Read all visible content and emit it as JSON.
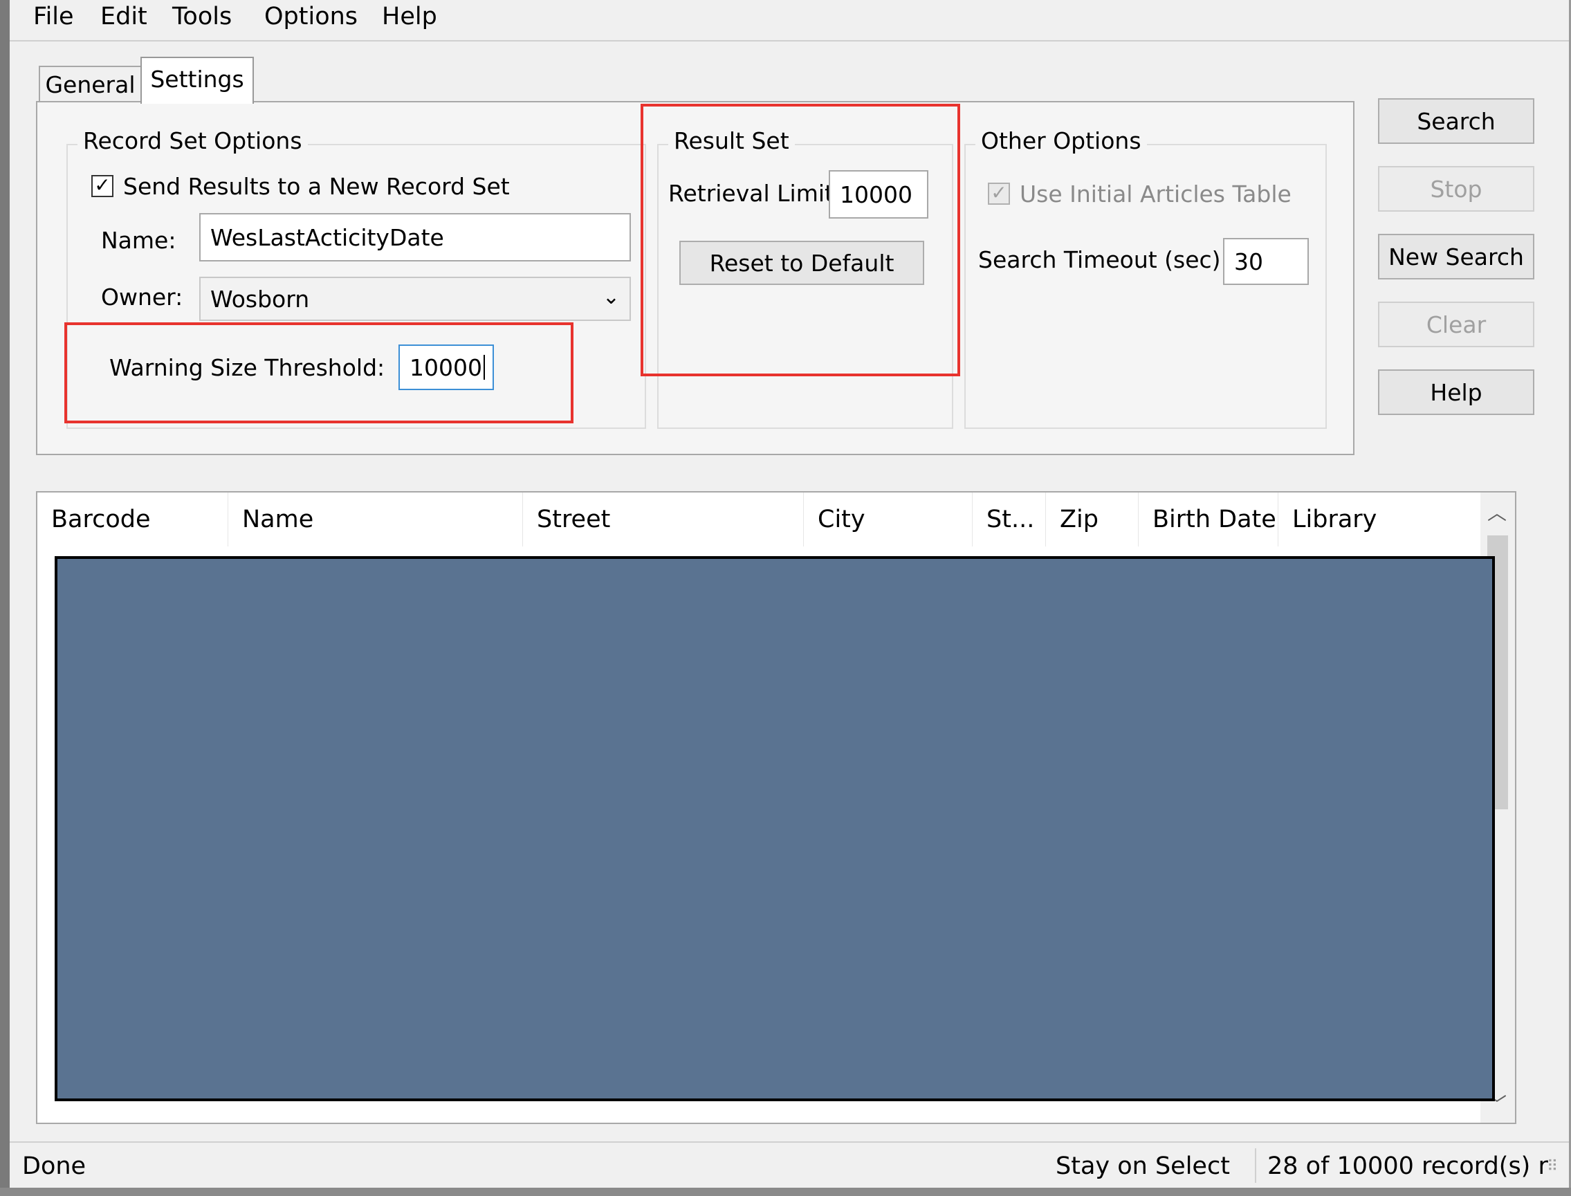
{
  "menu": [
    "File",
    "Edit",
    "Tools",
    "Options",
    "Help"
  ],
  "tabs": {
    "general": "General",
    "settings": "Settings"
  },
  "record_set_options": {
    "title": "Record Set Options",
    "send_results_label": "Send Results to a New Record Set",
    "send_results_checked": true,
    "name_label": "Name:",
    "name_value": "WesLastActicityDate",
    "owner_label": "Owner:",
    "owner_value": "Wosborn",
    "warning_label": "Warning Size Threshold:",
    "warning_value": "10000"
  },
  "result_set": {
    "title": "Result Set",
    "retrieval_label": "Retrieval Limit:",
    "retrieval_value": "10000",
    "reset_label": "Reset to Default"
  },
  "other_options": {
    "title": "Other Options",
    "initial_articles_label": "Use Initial Articles Table",
    "initial_articles_checked": true,
    "timeout_label": "Search Timeout (sec):",
    "timeout_value": "30"
  },
  "buttons": {
    "search": "Search",
    "stop": "Stop",
    "new_search": "New Search",
    "clear": "Clear",
    "help": "Help"
  },
  "columns": [
    "Barcode",
    "Name",
    "Street",
    "City",
    "St...",
    "Zip",
    "Birth Date",
    "Library"
  ],
  "status": {
    "left": "Done",
    "middle": "Stay on Select",
    "right": "28 of 10000 record(s) r"
  },
  "colors": {
    "highlight_box": "#e8332e",
    "redaction": "#5a7391"
  }
}
